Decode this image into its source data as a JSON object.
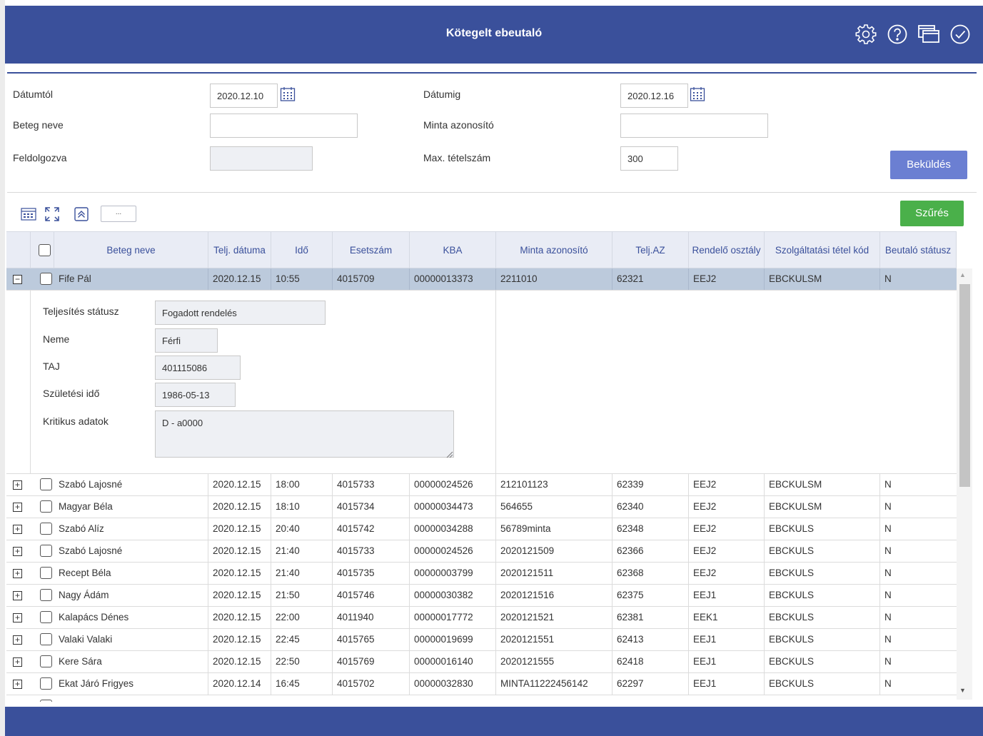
{
  "header": {
    "title": "Kötegelt ebeutaló",
    "icons": [
      "settings-icon",
      "help-icon",
      "windows-icon",
      "check-circle-icon"
    ]
  },
  "form": {
    "date_from_label": "Dátumtól",
    "date_from_value": "2020.12.10",
    "date_to_label": "Dátumig",
    "date_to_value": "2020.12.16",
    "patient_name_label": "Beteg neve",
    "patient_name_value": "",
    "sample_id_label": "Minta azonosító",
    "sample_id_value": "",
    "processed_label": "Feldolgozva",
    "processed_value": "",
    "max_items_label": "Max. tételszám",
    "max_items_value": "300",
    "submit_label": "Beküldés"
  },
  "toolbar": {
    "filter_label": "Szűrés",
    "dots_label": "..."
  },
  "grid": {
    "columns": [
      "Beteg neve",
      "Telj. dátuma",
      "Idő",
      "Esetszám",
      "KBA",
      "Minta azonosító",
      "Telj.AZ",
      "Rendelő osztály",
      "Szolgáltatási tétel kód",
      "Beutaló státusz"
    ],
    "expanded_row": {
      "name": "Fife Pál",
      "date": "2020.12.15",
      "time": "10:55",
      "case": "4015709",
      "kba": "00000013373",
      "sample": "2211010",
      "telj_az": "62321",
      "dept": "EEJ2",
      "code": "EBCKULSM",
      "status": "N"
    },
    "detail": {
      "completion_status_label": "Teljesítés státusz",
      "completion_status_value": "Fogadott rendelés",
      "sex_label": "Neme",
      "sex_value": "Férfi",
      "taj_label": "TAJ",
      "taj_value": "401115086",
      "birth_label": "Születési idő",
      "birth_value": "1986-05-13",
      "critical_label": "Kritikus adatok",
      "critical_value": "D - a0000"
    },
    "rows": [
      {
        "name": "Szabó Lajosné",
        "date": "2020.12.15",
        "time": "18:00",
        "case": "4015733",
        "kba": "00000024526",
        "sample": "212101123",
        "telj_az": "62339",
        "dept": "EEJ2",
        "code": "EBCKULSM",
        "status": "N"
      },
      {
        "name": "Magyar Béla",
        "date": "2020.12.15",
        "time": "18:10",
        "case": "4015734",
        "kba": "00000034473",
        "sample": "564655",
        "telj_az": "62340",
        "dept": "EEJ2",
        "code": "EBCKULSM",
        "status": "N"
      },
      {
        "name": "Szabó Alíz",
        "date": "2020.12.15",
        "time": "20:40",
        "case": "4015742",
        "kba": "00000034288",
        "sample": "56789minta",
        "telj_az": "62348",
        "dept": "EEJ2",
        "code": "EBCKULS",
        "status": "N"
      },
      {
        "name": "Szabó Lajosné",
        "date": "2020.12.15",
        "time": "21:40",
        "case": "4015733",
        "kba": "00000024526",
        "sample": "2020121509",
        "telj_az": "62366",
        "dept": "EEJ2",
        "code": "EBCKULS",
        "status": "N"
      },
      {
        "name": "Recept Béla",
        "date": "2020.12.15",
        "time": "21:40",
        "case": "4015735",
        "kba": "00000003799",
        "sample": "2020121511",
        "telj_az": "62368",
        "dept": "EEJ2",
        "code": "EBCKULS",
        "status": "N"
      },
      {
        "name": "Nagy Ádám",
        "date": "2020.12.15",
        "time": "21:50",
        "case": "4015746",
        "kba": "00000030382",
        "sample": "2020121516",
        "telj_az": "62375",
        "dept": "EEJ1",
        "code": "EBCKULS",
        "status": "N"
      },
      {
        "name": "Kalapács Dénes",
        "date": "2020.12.15",
        "time": "22:00",
        "case": "4011940",
        "kba": "00000017772",
        "sample": "2020121521",
        "telj_az": "62381",
        "dept": "EEK1",
        "code": "EBCKULS",
        "status": "N"
      },
      {
        "name": "Valaki Valaki",
        "date": "2020.12.15",
        "time": "22:45",
        "case": "4015765",
        "kba": "00000019699",
        "sample": "2020121551",
        "telj_az": "62413",
        "dept": "EEJ1",
        "code": "EBCKULS",
        "status": "N"
      },
      {
        "name": "Kere Sára",
        "date": "2020.12.15",
        "time": "22:50",
        "case": "4015769",
        "kba": "00000016140",
        "sample": "2020121555",
        "telj_az": "62418",
        "dept": "EEJ1",
        "code": "EBCKULS",
        "status": "N"
      },
      {
        "name": "Ekat Járó Frigyes",
        "date": "2020.12.14",
        "time": "16:45",
        "case": "4015702",
        "kba": "00000032830",
        "sample": "MINTA11222456142",
        "telj_az": "62297",
        "dept": "EEJ1",
        "code": "EBCKULS",
        "status": "N"
      }
    ]
  },
  "colors": {
    "brand": "#3a509b",
    "submit": "#6b7fd2",
    "filter": "#4ab04a",
    "selected_row": "#bccadc"
  }
}
